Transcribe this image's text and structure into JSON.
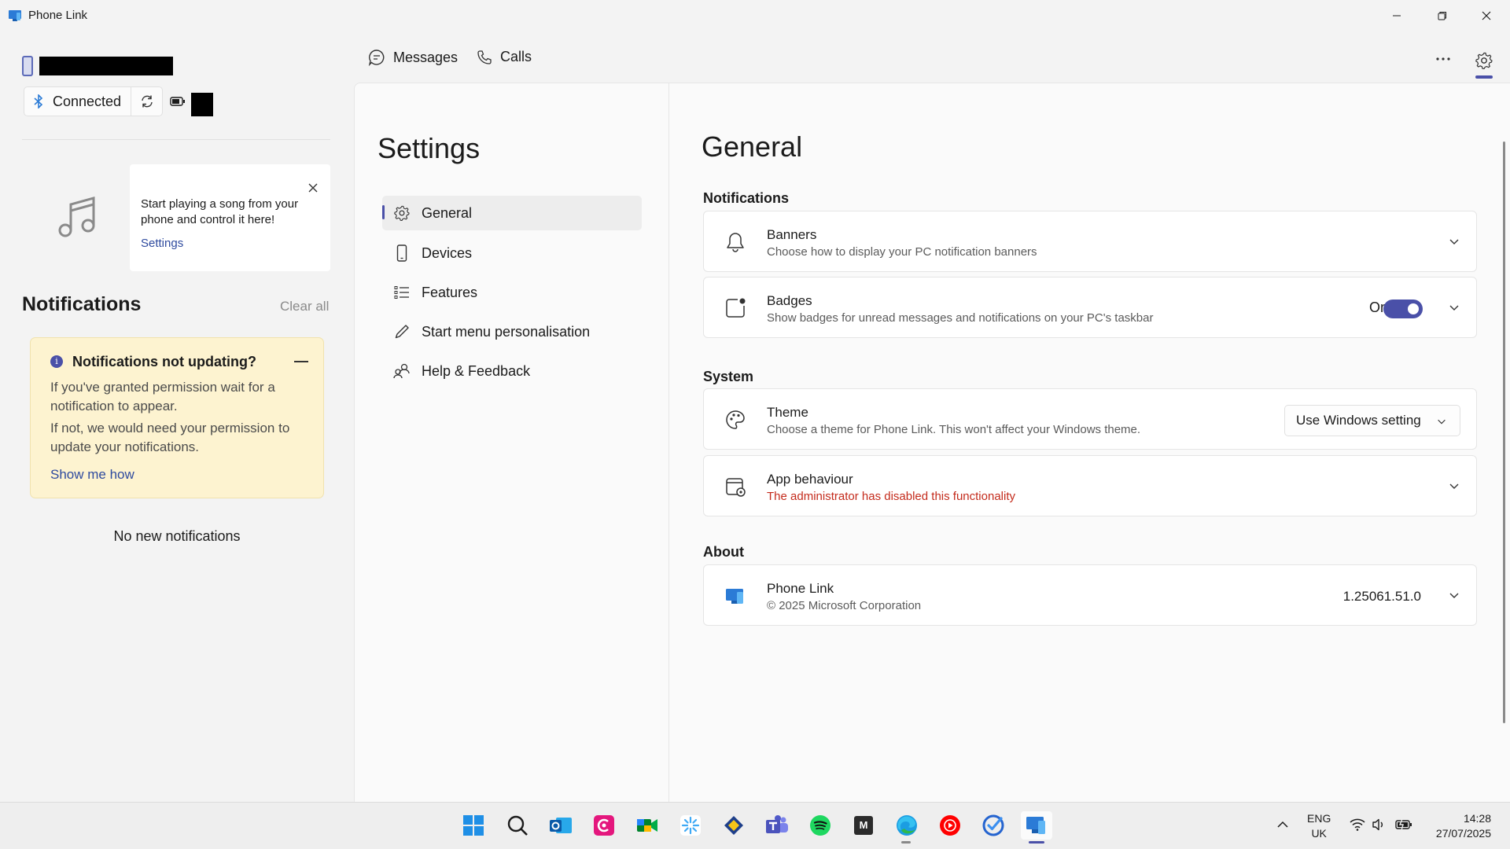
{
  "window": {
    "title": "Phone Link"
  },
  "device": {
    "status": "Connected"
  },
  "music": {
    "message": "Start playing a song from your phone and control it here!",
    "link": "Settings"
  },
  "notifications": {
    "title": "Notifications",
    "clear_all": "Clear all",
    "warning": {
      "title": "Notifications not updating?",
      "line1": "If you've granted permission wait for a notification to appear.",
      "line2": "If not, we would need your permission to update your notifications.",
      "link": "Show me how"
    },
    "empty": "No new notifications"
  },
  "tabs": [
    {
      "label": "Messages"
    },
    {
      "label": "Calls"
    }
  ],
  "settings": {
    "title": "Settings",
    "nav": [
      {
        "label": "General",
        "icon": "gear-icon"
      },
      {
        "label": "Devices",
        "icon": "phone-icon"
      },
      {
        "label": "Features",
        "icon": "list-icon"
      },
      {
        "label": "Start menu personalisation",
        "icon": "pen-icon"
      },
      {
        "label": "Help & Feedback",
        "icon": "people-icon"
      }
    ]
  },
  "general": {
    "title": "General",
    "sections": {
      "notifications": "Notifications",
      "system": "System",
      "about": "About"
    },
    "banners": {
      "title": "Banners",
      "subtitle": "Choose how to display your PC notification banners"
    },
    "badges": {
      "title": "Badges",
      "subtitle": "Show badges for unread messages and notifications on your PC's taskbar",
      "toggle_label": "On",
      "enabled": true
    },
    "theme": {
      "title": "Theme",
      "subtitle": "Choose a theme for Phone Link. This won't affect your Windows theme.",
      "selected": "Use Windows setting"
    },
    "app_behaviour": {
      "title": "App behaviour",
      "subtitle": "The administrator has disabled this functionality"
    },
    "about": {
      "title": "Phone Link",
      "subtitle": "© 2025 Microsoft Corporation",
      "version": "1.25061.51.0"
    }
  },
  "taskbar": {
    "apps": [
      "start",
      "search",
      "outlook",
      "cisco",
      "meet",
      "app-asterisk",
      "app-shield",
      "teams",
      "spotify",
      "app-m",
      "edge",
      "youtube-music",
      "todo",
      "phone-link"
    ],
    "m_label": "M",
    "language": "ENG",
    "region": "UK",
    "time": "14:28",
    "date": "27/07/2025"
  },
  "colors": {
    "accent": "#4a50a8",
    "error": "#c42b1c",
    "link": "#2e4a9e",
    "warning_bg": "#fdf3d0"
  }
}
